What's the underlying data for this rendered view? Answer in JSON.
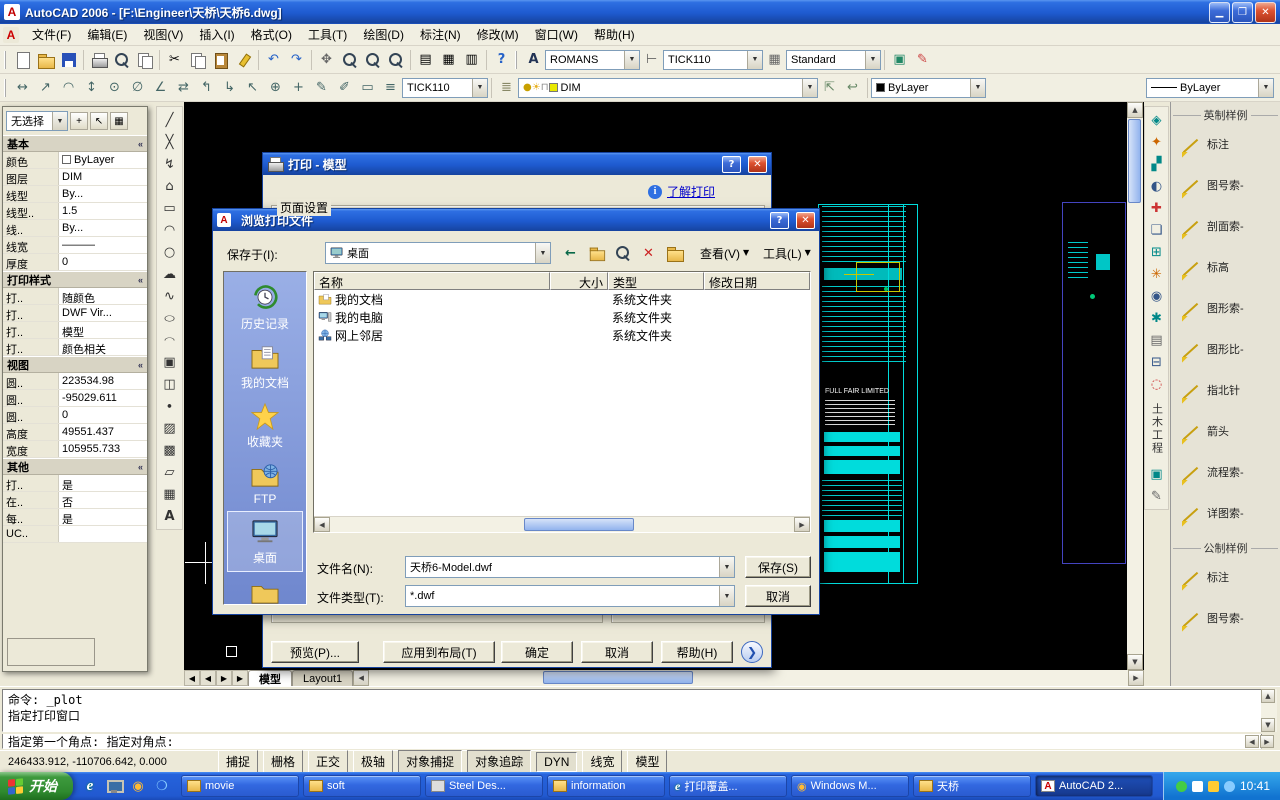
{
  "window": {
    "title": "AutoCAD 2006 - [F:\\Engineer\\天桥\\天桥6.dwg]"
  },
  "menubar": {
    "items": [
      "文件(F)",
      "编辑(E)",
      "视图(V)",
      "插入(I)",
      "格式(O)",
      "工具(T)",
      "绘图(D)",
      "标注(N)",
      "修改(M)",
      "窗口(W)",
      "帮助(H)"
    ]
  },
  "toolbars": {
    "text_style": "ROMANS",
    "dim_style": "TICK110",
    "table_style": "Standard",
    "dim_style2": "TICK110",
    "layer": "DIM",
    "color": "ByLayer",
    "linetype": "ByLayer"
  },
  "icons": [
    "new-file",
    "open-file",
    "save",
    "plot",
    "plot-preview",
    "publish",
    "cut",
    "copy",
    "paste",
    "match-properties",
    "undo",
    "redo",
    "pan",
    "zoom-realtime",
    "zoom-window",
    "zoom-previous",
    "properties",
    "designcenter",
    "tool-palettes",
    "help",
    "line",
    "construction-line",
    "polyline",
    "polygon",
    "rectangle",
    "arc",
    "circle",
    "revision-cloud",
    "spline",
    "ellipse",
    "insert-block",
    "make-block",
    "point",
    "hatch",
    "gradient",
    "region",
    "table",
    "multiline-text",
    "back",
    "up-one-level",
    "search-web",
    "delete",
    "new-folder",
    "history",
    "my-documents",
    "favorites",
    "ftp",
    "desktop",
    "folder",
    "computer",
    "network"
  ],
  "properties": {
    "selection": "无选择",
    "sections": [
      {
        "title": "基本",
        "rows": [
          {
            "label": "颜色",
            "value": "ByLayer"
          },
          {
            "label": "图层",
            "value": "DIM"
          },
          {
            "label": "线型",
            "value": "By..."
          },
          {
            "label": "线型..",
            "value": "1.5"
          },
          {
            "label": "线..",
            "value": "By..."
          },
          {
            "label": "线宽",
            "value": "———"
          },
          {
            "label": "厚度",
            "value": "0"
          }
        ]
      },
      {
        "title": "打印样式",
        "rows": [
          {
            "label": "打..",
            "value": "随颜色"
          },
          {
            "label": "打..",
            "value": "DWF Vir..."
          },
          {
            "label": "打..",
            "value": "模型"
          },
          {
            "label": "打..",
            "value": "颜色相关"
          }
        ]
      },
      {
        "title": "视图",
        "rows": [
          {
            "label": "圆..",
            "value": "223534.98"
          },
          {
            "label": "圆..",
            "value": "-95029.611"
          },
          {
            "label": "圆..",
            "value": "0"
          },
          {
            "label": "高度",
            "value": "49551.437"
          },
          {
            "label": "宽度",
            "value": "105955.733"
          }
        ]
      },
      {
        "title": "其他",
        "rows": [
          {
            "label": "打..",
            "value": "是"
          },
          {
            "label": "在..",
            "value": "否"
          },
          {
            "label": "每..",
            "value": "是"
          },
          {
            "label": "UC..",
            "value": ""
          }
        ]
      }
    ]
  },
  "plot_dialog": {
    "title": "打印 - 模型",
    "learn_link": "了解打印",
    "page_setup": "页面设置",
    "preview_btn": "预览(P)...",
    "apply_btn": "应用到布局(T)",
    "ok_btn": "确定",
    "cancel_btn": "取消",
    "help_btn": "帮助(H)"
  },
  "browse_dialog": {
    "title": "浏览打印文件",
    "save_in_label": "保存于(I):",
    "save_in_value": "桌面",
    "view_btn": "查看(V)",
    "tools_btn": "工具(L)",
    "places": [
      "历史记录",
      "我的文档",
      "收藏夹",
      "FTP",
      "桌面"
    ],
    "columns": [
      "名称",
      "大小",
      "类型",
      "修改日期"
    ],
    "files": [
      {
        "name": "我的文档",
        "size": "",
        "type": "系统文件夹",
        "date": ""
      },
      {
        "name": "我的电脑",
        "size": "",
        "type": "系统文件夹",
        "date": ""
      },
      {
        "name": "网上邻居",
        "size": "",
        "type": "系统文件夹",
        "date": ""
      }
    ],
    "filename_label": "文件名(N):",
    "filename_value": "天桥6-Model.dwf",
    "filetype_label": "文件类型(T):",
    "filetype_value": "*.dwf",
    "save_btn": "保存(S)",
    "cancel_btn": "取消"
  },
  "tool_palette": {
    "tab_label": "土木工程",
    "sections": [
      {
        "title": "英制样例",
        "items": [
          "标注",
          "图号索-",
          "剖面索-",
          "标高",
          "图形索-",
          "图形比-",
          "指北针",
          "箭头",
          "流程索-",
          "详图索-"
        ]
      },
      {
        "title": "公制样例",
        "items": [
          "标注",
          "图号索-"
        ]
      }
    ]
  },
  "layout_tabs": {
    "model": "模型",
    "layout1": "Layout1"
  },
  "command": {
    "lines": [
      "命令: _plot",
      "指定打印窗口"
    ],
    "prompt": "指定第一个角点: 指定对角点:"
  },
  "statusbar": {
    "coords": "246433.912, -110706.642, 0.000",
    "toggles": [
      "捕捉",
      "栅格",
      "正交",
      "极轴",
      "对象捕捉",
      "对象追踪",
      "DYN",
      "线宽",
      "模型"
    ]
  },
  "taskbar": {
    "start": "开始",
    "tasks": [
      {
        "label": "movie"
      },
      {
        "label": "soft"
      },
      {
        "label": "Steel Des..."
      },
      {
        "label": "information"
      },
      {
        "label": "打印覆盖..."
      },
      {
        "label": "Windows M..."
      },
      {
        "label": "天桥"
      },
      {
        "label": "AutoCAD 2..."
      }
    ],
    "time": "10:41"
  },
  "drawing": {
    "sheet_title": "FULL FAIR LIMITED"
  }
}
